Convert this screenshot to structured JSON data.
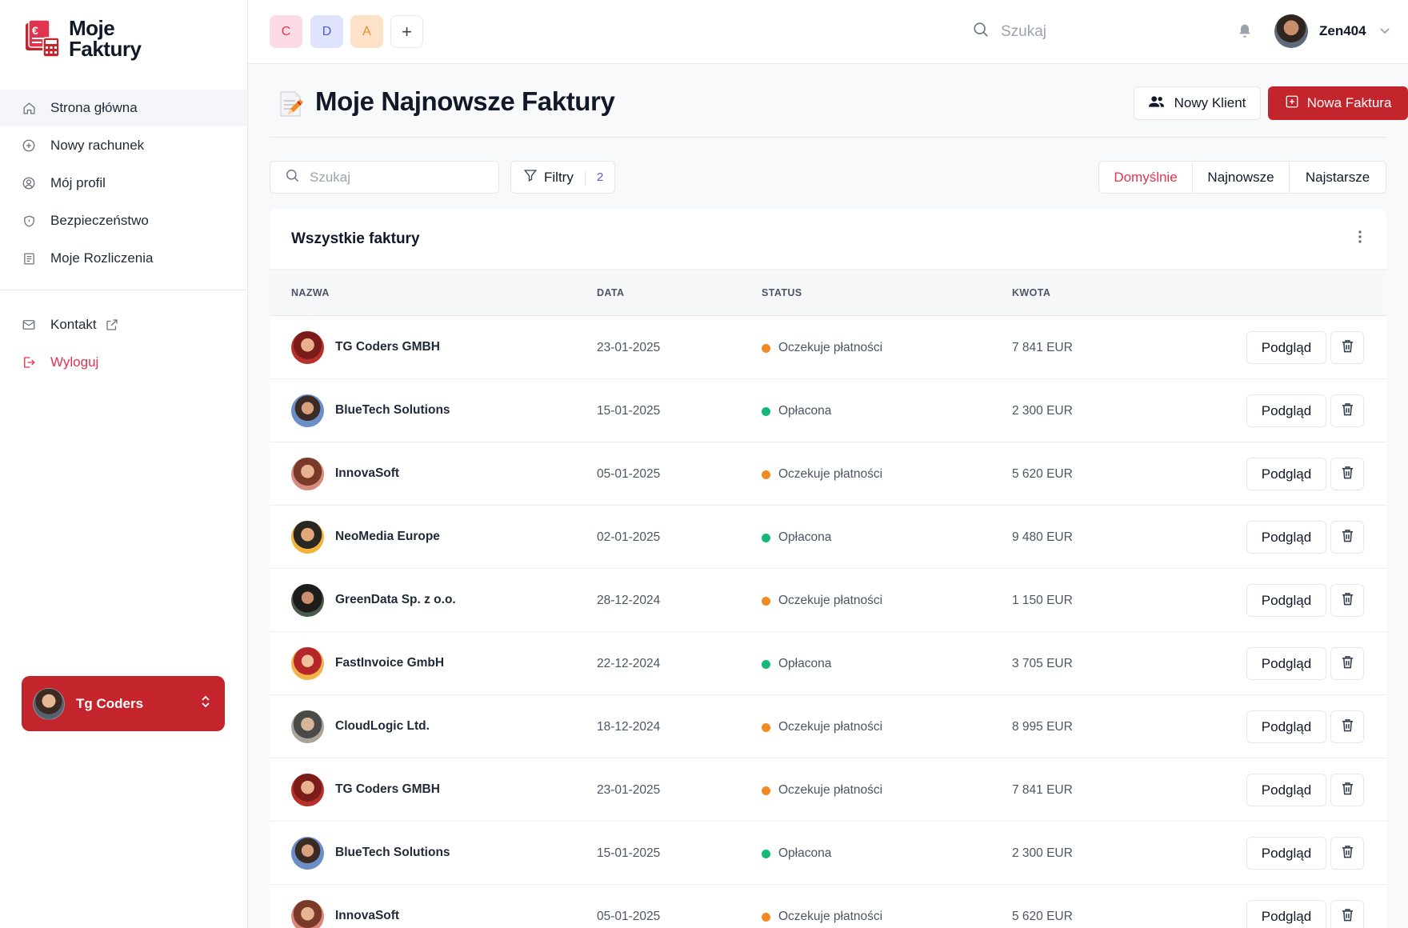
{
  "app": {
    "logo_line1": "Moje",
    "logo_line2": "Faktury"
  },
  "sidebar": {
    "items": [
      {
        "label": "Strona główna",
        "icon": "home-icon"
      },
      {
        "label": "Nowy rachunek",
        "icon": "plus-circle-icon"
      },
      {
        "label": "Mój profil",
        "icon": "user-circle-icon"
      },
      {
        "label": "Bezpieczeństwo",
        "icon": "shield-icon"
      },
      {
        "label": "Moje Rozliczenia",
        "icon": "receipt-icon"
      }
    ],
    "secondary": [
      {
        "label": "Kontakt",
        "icon": "mail-icon"
      },
      {
        "label": "Wyloguj",
        "icon": "logout-icon"
      }
    ],
    "account_name": "Tg Coders"
  },
  "topbar": {
    "chips": [
      "C",
      "D",
      "A"
    ],
    "add_label": "+",
    "search_placeholder": "Szukaj",
    "user_name": "Zen404"
  },
  "page": {
    "title": "Moje Najnowsze Faktury",
    "new_client_label": "Nowy Klient",
    "new_invoice_label": "Nowa Faktura",
    "search_placeholder": "Szukaj",
    "filters_label": "Filtry",
    "filters_count": "2",
    "sort_options": [
      "Domyślnie",
      "Najnowsze",
      "Najstarsze"
    ],
    "sort_selected": "Domyślnie"
  },
  "table": {
    "title": "Wszystkie faktury",
    "columns": [
      "NAZWA",
      "DATA",
      "STATUS",
      "KWOTA"
    ],
    "view_label": "Podgląd",
    "rows": [
      {
        "name": "TG Coders GMBH",
        "date": "23-01-2025",
        "status": "Oczekuje płatności",
        "amount": "7 841 EUR"
      },
      {
        "name": "BlueTech Solutions",
        "date": "15-01-2025",
        "status": "Opłacona",
        "amount": "2 300 EUR"
      },
      {
        "name": "InnovaSoft",
        "date": "05-01-2025",
        "status": "Oczekuje płatności",
        "amount": "5 620 EUR"
      },
      {
        "name": "NeoMedia Europe",
        "date": "02-01-2025",
        "status": "Opłacona",
        "amount": "9 480 EUR"
      },
      {
        "name": "GreenData Sp. z o.o.",
        "date": "28-12-2024",
        "status": "Oczekuje płatności",
        "amount": "1 150 EUR"
      },
      {
        "name": "FastInvoice GmbH",
        "date": "22-12-2024",
        "status": "Opłacona",
        "amount": "3 705 EUR"
      },
      {
        "name": "CloudLogic Ltd.",
        "date": "18-12-2024",
        "status": "Oczekuje płatności",
        "amount": "8 995 EUR"
      },
      {
        "name": "TG Coders GMBH",
        "date": "23-01-2025",
        "status": "Oczekuje płatności",
        "amount": "7 841 EUR"
      },
      {
        "name": "BlueTech Solutions",
        "date": "15-01-2025",
        "status": "Opłacona",
        "amount": "2 300 EUR"
      },
      {
        "name": "InnovaSoft",
        "date": "05-01-2025",
        "status": "Oczekuje płatności",
        "amount": "5 620 EUR"
      }
    ]
  },
  "colors": {
    "brand_red": "#c4242b",
    "accent_pink": "#e0344f",
    "status_pending": "#f28a22",
    "status_paid": "#16b87a"
  }
}
